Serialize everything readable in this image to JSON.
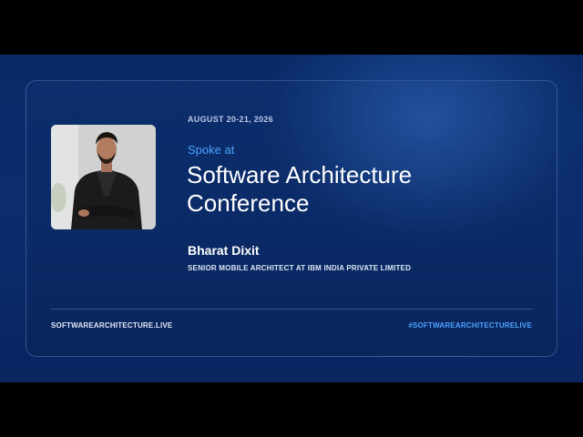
{
  "event": {
    "date": "AUGUST 20-21, 2026",
    "intro": "Spoke at",
    "title": "Software Architecture Conference"
  },
  "speaker": {
    "name": "Bharat Dixit",
    "role": "SENIOR MOBILE ARCHITECT AT IBM INDIA PRIVATE LIMITED",
    "photo_icon": "speaker-photo"
  },
  "footer": {
    "website": "SOFTWAREARCHITECTURE.LIVE",
    "hashtag": "#SOFTWAREARCHITECTURELIVE"
  },
  "colors": {
    "background": "#0a2a66",
    "accent": "#4da3ff",
    "text": "#ffffff",
    "letterbox": "#000000"
  }
}
